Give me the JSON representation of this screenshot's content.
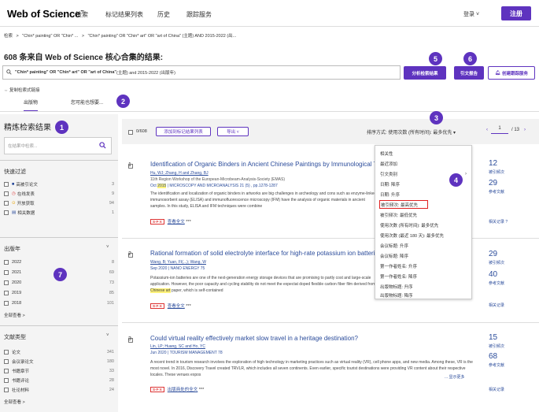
{
  "header": {
    "logo": "Web of Science",
    "logo_tm": "™",
    "nav": [
      "检索",
      "标记结果列表",
      "历史",
      "跟踪服务"
    ],
    "login": "登录 ˅",
    "register": "注册"
  },
  "breadcrumb": {
    "items": [
      "检索",
      "\"Chin* painting\" OR \"Chin* ...",
      "\"Chin* painting\" OR \"Chin* art\" OR \"art of China\" (主题) AND 2015-2022 (出..."
    ],
    "sep": ">"
  },
  "results": {
    "count": "608",
    "title_suffix": " 条来自 Web of Science 核心合集的结果:",
    "query_bold": "\"Chin* painting\" OR \"Chin* art\" OR \"art of China\"",
    "query_rest": " (主题) and 2015-2022 (出版年)",
    "copy_link": "复制检索式链接"
  },
  "actions": {
    "analyze": "分析检索结果",
    "citation_report": "引文报告",
    "create_alert": "创建跟踪服务"
  },
  "tabs": [
    "出版物",
    "您可能也想要..."
  ],
  "badges": [
    "1",
    "2",
    "3",
    "4",
    "5",
    "6",
    "7"
  ],
  "sidebar": {
    "title": "精炼检索结果",
    "search_placeholder": "在结果中检索...",
    "quick_filter": {
      "heading": "快速过滤",
      "items": [
        {
          "label": "高被引论文",
          "count": "3",
          "icon": "trophy-icon",
          "color": "#2b4c9b"
        },
        {
          "label": "在线发表",
          "count": "9",
          "icon": "clock-icon",
          "color": "#d33"
        },
        {
          "label": "开放获取",
          "count": "94",
          "icon": "lock-open-icon",
          "color": "#e8a200"
        },
        {
          "label": "相关数据",
          "count": "1",
          "icon": "data-icon",
          "color": "#2b4c9b"
        }
      ]
    },
    "pub_year": {
      "heading": "出版年",
      "items": [
        {
          "label": "2022",
          "count": "8"
        },
        {
          "label": "2021",
          "count": "69"
        },
        {
          "label": "2020",
          "count": "73"
        },
        {
          "label": "2019",
          "count": "85"
        },
        {
          "label": "2018",
          "count": "101"
        }
      ],
      "see_all": "全部查看 >"
    },
    "doc_type": {
      "heading": "文献类型",
      "items": [
        {
          "label": "论文",
          "count": "341"
        },
        {
          "label": "会议录论文",
          "count": "180"
        },
        {
          "label": "书籍章节",
          "count": "33"
        },
        {
          "label": "书籍评论",
          "count": "28"
        },
        {
          "label": "社论材料",
          "count": "24"
        }
      ],
      "see_all": "全部查看 >"
    }
  },
  "toolbar": {
    "selected": "0/608",
    "add_to_marked": "添加到标记结果列表",
    "export": "导出 ˅",
    "sort_label": "排序方式: 使用次数 (所有时间): 最多优先 ▾",
    "page_current": "1",
    "page_total": "/ 13"
  },
  "sort_menu": [
    "相关性",
    "最近添加",
    "引文类别",
    "日期: 降序",
    "日期: 升序",
    "被引频次: 最高优先",
    "被引频次: 最低优先",
    "使用次数 (所有时间): 最多优先",
    "使用次数 (最近 180 天): 最多优先",
    "会议标题: 升序",
    "会议标题: 降序",
    "第一作者姓名: 升序",
    "第一作者姓名: 降序",
    "出版物标题: 升序",
    "出版物标题: 降序"
  ],
  "records": [
    {
      "num": "1",
      "title": "Identification of Organic Binders in Ancient Chinese Paintings by Immunological Te",
      "authors": "Hu, WJ; Zhang, H and Zhang, BJ",
      "source": "11th Region Workshop of the European-Microbeam-Analysis-Society (EMAS)",
      "date_pre": "Oct ",
      "date_hl": "2015",
      "date_post": " | MICROSCOPY AND MICROANALYSIS 21 (5) , pp.1278-1287",
      "abstract": "The identification and localization of organic binders in artworks are big challenges in archeology and cons such as enzyme-linked immunosorbent assay (ELISA) and immunofluorescence microscopy (IFM) have the analysis of organic materials in ancient samples. In this study, ELISA and IFM techniques were combine",
      "sfx": "S·F·X",
      "fulltext": "查看全文",
      "more": "***",
      "citations": "12",
      "citations_label": "被引频次",
      "refs": "29",
      "refs_label": "参考文献",
      "related": "相关记录 ?"
    },
    {
      "num": "2",
      "title": "Rational formation of solid electrolyte interface for high-rate potassium ion batterie",
      "authors": "Wang, B; Yuan, FI(...); Wang, W",
      "date_pre": "Sep 2020 | ",
      "date_hl": "",
      "date_post": "NANO ENERGY 75",
      "abstract_a": "Potassium-ion batteries are one of the next-generation energy storage devices that are promising to partly cost and large-scale application. However, the poor capacity and cycling stability do not meet the expectat doped flexible carbon fiber film derived from ",
      "abstract_hl": "Chinese art",
      "abstract_b": " paper, which is self-contained",
      "sfx": "S·F·X",
      "fulltext": "查看全文",
      "more": "***",
      "citations": "29",
      "citations_label": "被引频次",
      "refs": "40",
      "refs_label": "参考文献",
      "related": "相关记录"
    },
    {
      "num": "3",
      "title": "Could virtual reality effectively market slow travel in a heritage destination?",
      "authors": "Lin, LP; Huang, SC and Ho, YC",
      "date_pre": "Jun 2020 | ",
      "date_hl": "",
      "date_post": "TOURISM MANAGEMENT 78",
      "abstract": "A recent trend in tourism research involves the exploration of high technology in marketing practices such as virtual reality (VR), cell phone apps, and new media. Among these, VR is the most novel. In 2016, Discovery Travel created TRVLR, which includes all seven continents. Even earlier, specific tourist destinations were providing VR content about their respective locales. These venues expos",
      "show_more": "... 显示更多",
      "sfx": "S·F·X",
      "fulltext": "出版商处的全文",
      "more": "***",
      "citations": "15",
      "citations_label": "被引频次",
      "refs": "68",
      "refs_label": "参考文献",
      "related": "相关记录"
    }
  ]
}
